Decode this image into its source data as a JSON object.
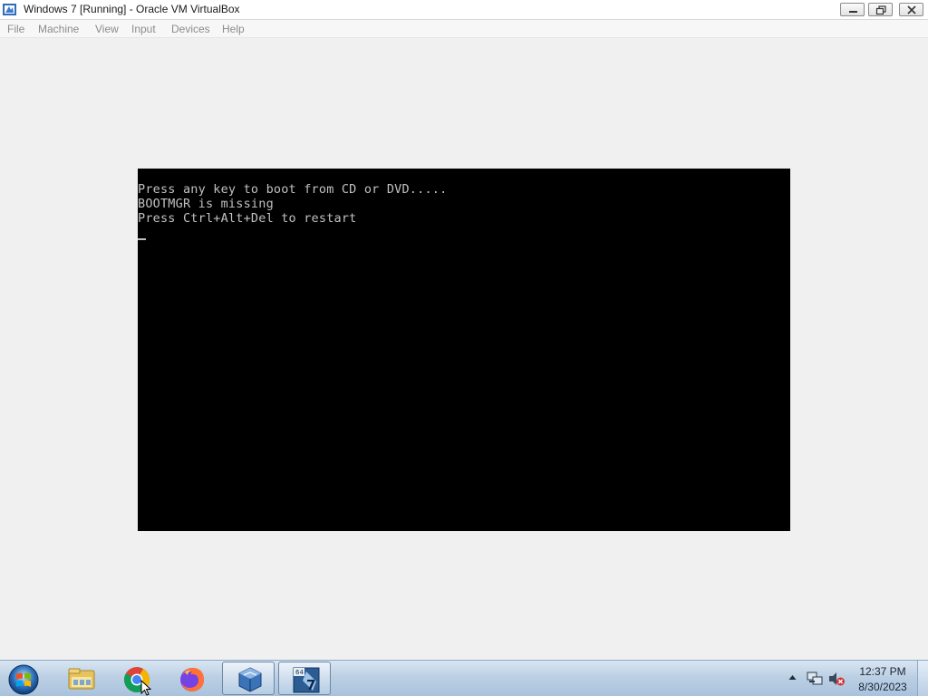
{
  "window": {
    "title": "Windows 7 [Running] - Oracle VM VirtualBox",
    "controls": [
      "minimize",
      "restore",
      "close"
    ]
  },
  "menu": {
    "items": [
      "File",
      "Machine",
      "View",
      "Input",
      "Devices",
      "Help"
    ]
  },
  "console": {
    "lines": [
      "Press any key to boot from CD or DVD.....",
      "BOOTMGR is missing",
      "Press Ctrl+Alt+Del to restart"
    ],
    "cursor": "_"
  },
  "taskbar": {
    "start_icon": "windows-start-orb-icon",
    "apps": [
      {
        "icon": "file-explorer-icon",
        "active": false
      },
      {
        "icon": "chrome-icon",
        "active": false
      },
      {
        "icon": "firefox-icon",
        "active": false
      },
      {
        "icon": "virtualbox-icon",
        "active": true
      },
      {
        "icon": "windows7-vm-icon",
        "active": true
      }
    ],
    "tray_icons": [
      "show-hidden-icons-chevron",
      "network-icon",
      "volume-muted-icon"
    ],
    "clock": {
      "time": "12:37 PM",
      "date": "8/30/2023"
    }
  },
  "colors": {
    "console_bg": "#000000",
    "console_fg": "#c0c0c0",
    "host_bg": "#f0f0f0",
    "taskbar": "#bcd0e4"
  }
}
